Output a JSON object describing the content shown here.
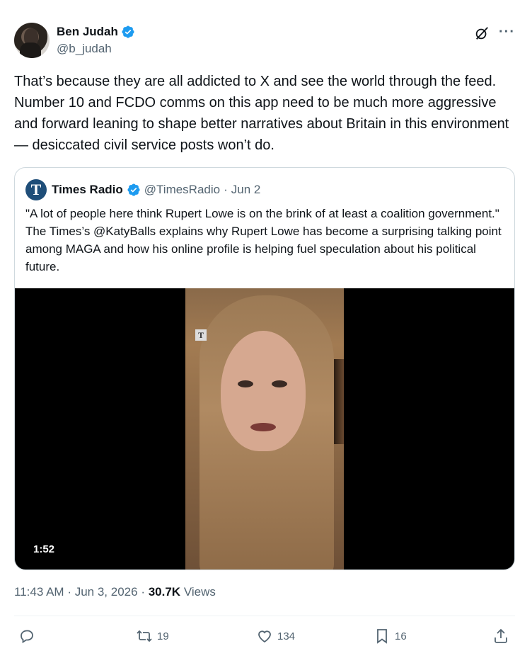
{
  "author": {
    "name": "Ben Judah",
    "handle": "@b_judah"
  },
  "tweet": {
    "text": "That’s because they are all addicted to X and see the world through the feed. Number 10 and FCDO comms on this app need to be much more aggressive and forward leaning to shape better narratives about Britain in this environment — desiccated civil service posts won’t do."
  },
  "quote": {
    "avatar_letter": "T",
    "name": "Times Radio",
    "handle": "@TimesRadio",
    "separator": "·",
    "date": "Jun 2",
    "text": "\"A lot of people here think Rupert Lowe is on the brink of at least a coalition government.\" The Times’s @KatyBalls explains why Rupert Lowe has become a surprising talking point among MAGA and how his online profile is helping fuel speculation about his political future.",
    "video": {
      "duration": "1:52",
      "watermark": "T"
    }
  },
  "meta": {
    "time": "11:43 AM",
    "sep1": "·",
    "date": "Jun 3, 2026",
    "sep2": "·",
    "views_count": "30.7K",
    "views_label": "Views"
  },
  "actions": {
    "reply_count": "",
    "retweet_count": "19",
    "like_count": "134",
    "bookmark_count": "16"
  },
  "colors": {
    "verified_blue": "#1d9bf0",
    "text_secondary": "#536471",
    "border": "#cfd9de"
  },
  "icons": [
    "verified-icon",
    "grok-icon",
    "more-icon",
    "reply-icon",
    "retweet-icon",
    "like-icon",
    "bookmark-icon",
    "share-icon"
  ]
}
